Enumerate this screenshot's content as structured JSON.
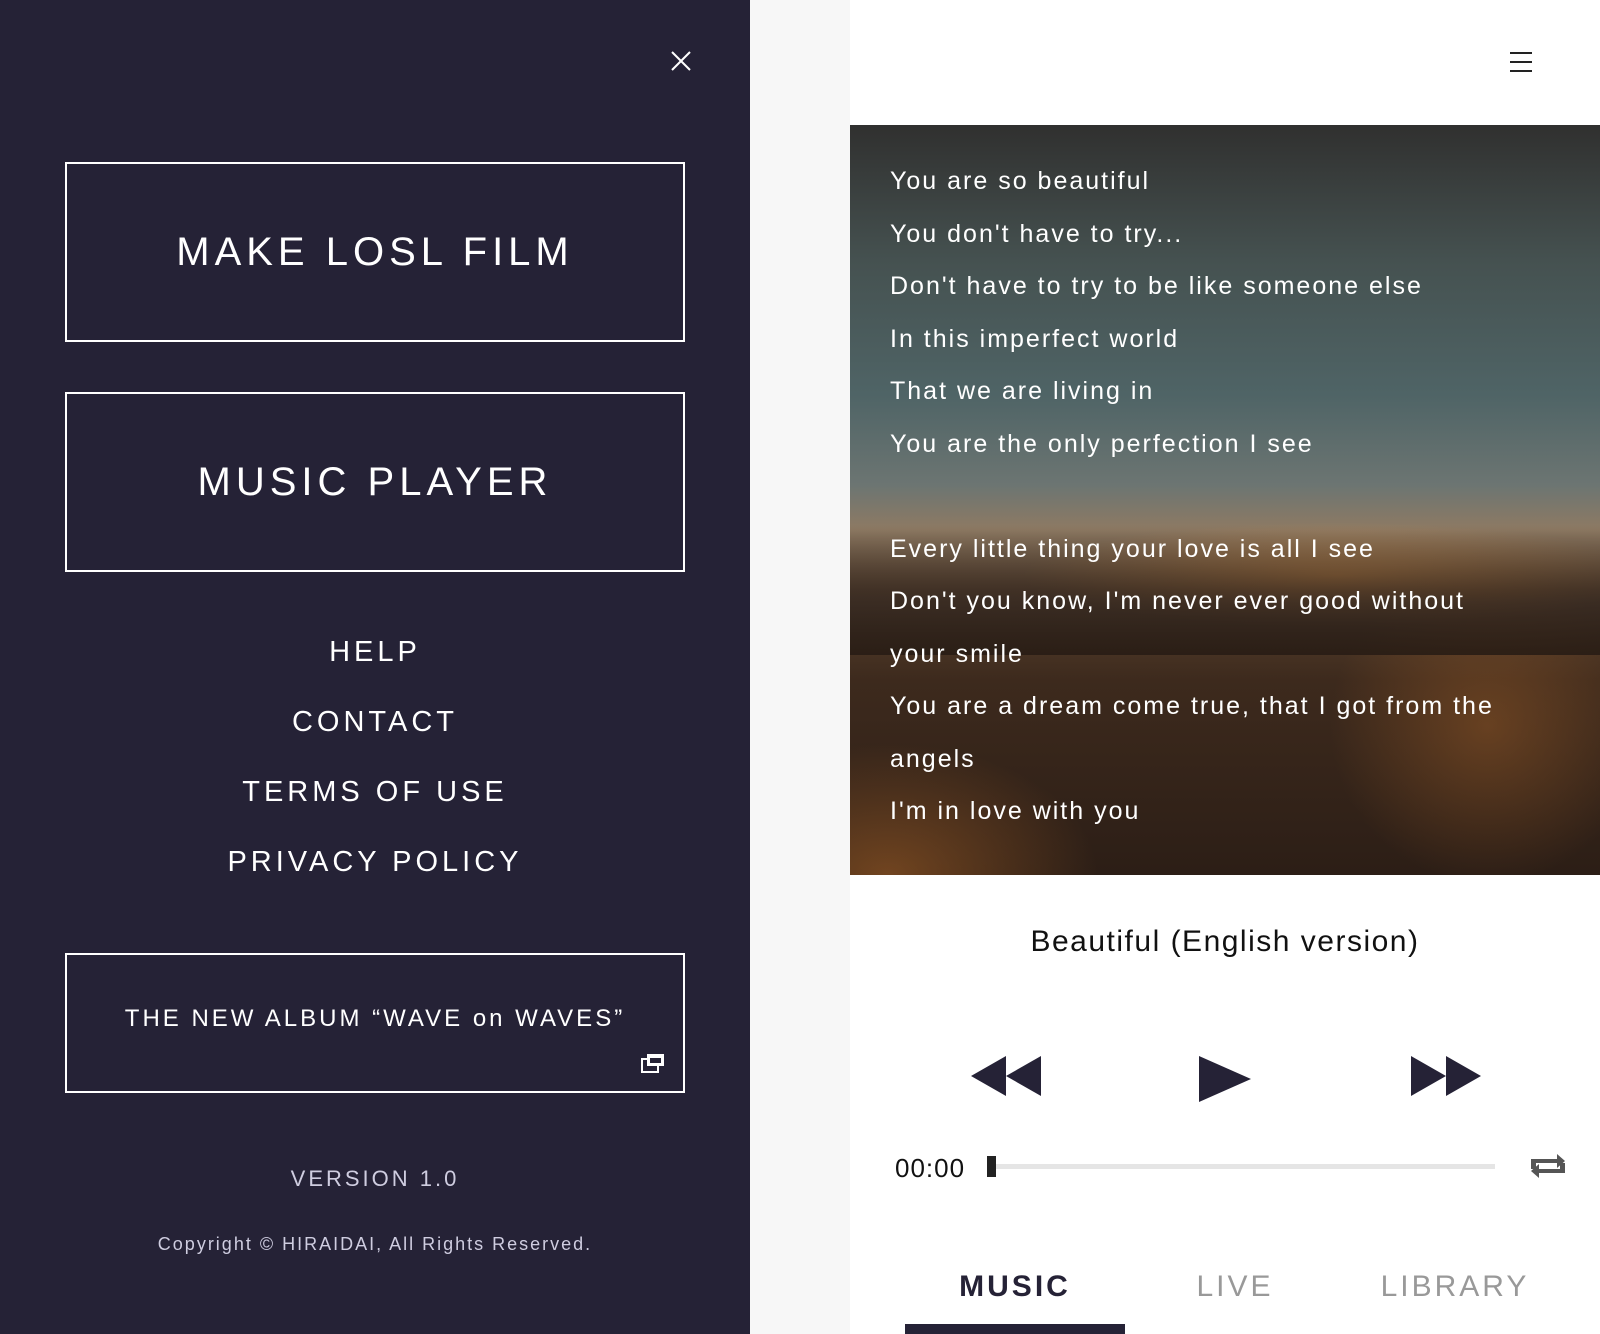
{
  "drawer": {
    "primary_buttons": [
      "MAKE LOSL FILM",
      "MUSIC PLAYER"
    ],
    "links": [
      "HELP",
      "CONTACT",
      "TERMS OF USE",
      "PRIVACY POLICY"
    ],
    "album_label": "THE NEW ALBUM “WAVE on WAVES”",
    "version": "VERSION 1.0",
    "copyright": "Copyright © HIRAIDAI, All Rights Reserved."
  },
  "player": {
    "lyrics": [
      "You are so beautiful",
      "You don't have to try...",
      "Don't have to try to be like someone else",
      "In this imperfect world",
      "That we are living in",
      "You are the only perfection I see",
      "",
      "Every little thing your love is all I see",
      "Don't you know, I'm never ever good without",
      "your smile",
      "You are a dream come true, that I got from the",
      "angels",
      "I'm in love with you"
    ],
    "song_title": "Beautiful (English version)",
    "time": "00:00",
    "progress_fraction": 0,
    "tabs": [
      "MUSIC",
      "LIVE",
      "LIBRARY"
    ],
    "active_tab": "MUSIC"
  },
  "icons": {
    "close": "close-icon",
    "menu": "hamburger-menu-icon",
    "external": "external-link-icon",
    "prev": "rewind-icon",
    "play": "play-icon",
    "next": "fast-forward-icon",
    "repeat": "repeat-icon"
  },
  "colors": {
    "drawer_bg": "#252236",
    "accent": "#252236",
    "inactive_tab": "#999999"
  }
}
